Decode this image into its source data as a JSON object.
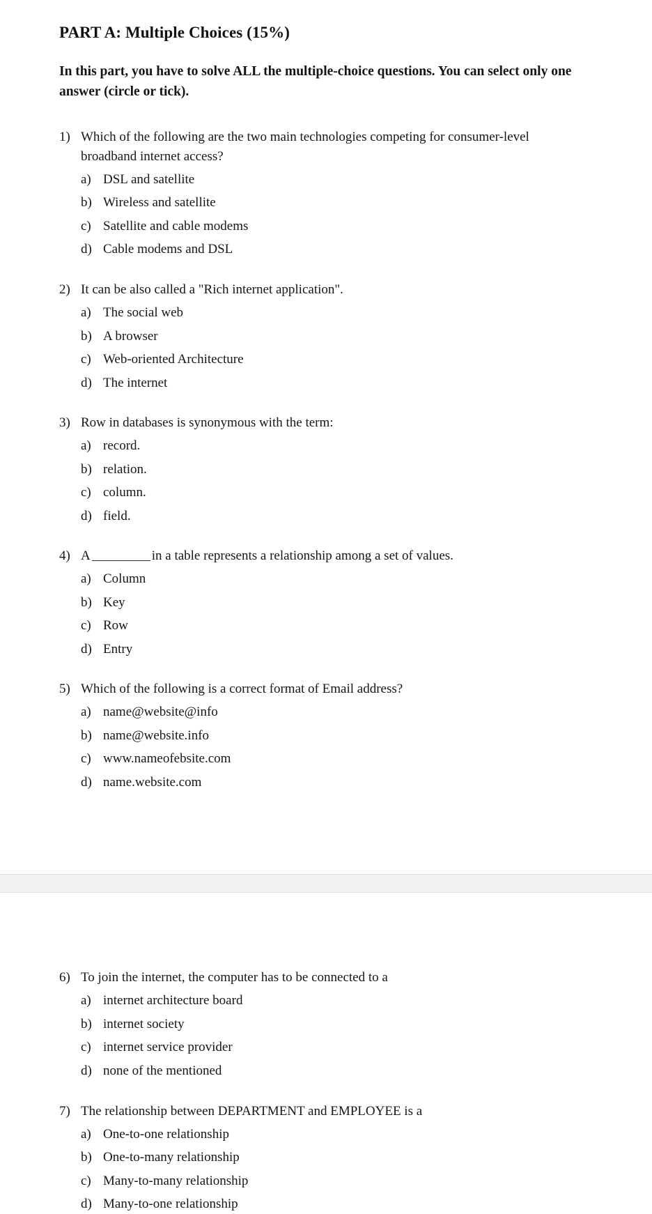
{
  "document": {
    "part_title": "PART A: Multiple Choices (15%)",
    "intro": "In this part, you have to solve ALL the multiple-choice questions. You can select only one answer (circle or tick).",
    "questions": [
      {
        "number": "1)",
        "text": "Which of the following are the two main technologies competing for consumer-level broadband internet access?",
        "options": [
          {
            "letter": "a)",
            "text": "DSL and satellite"
          },
          {
            "letter": "b)",
            "text": "Wireless and satellite"
          },
          {
            "letter": "c)",
            "text": "Satellite and cable modems"
          },
          {
            "letter": "d)",
            "text": "Cable modems and DSL"
          }
        ]
      },
      {
        "number": "2)",
        "text": "It can be also called a \"Rich internet application\".",
        "options": [
          {
            "letter": "a)",
            "text": "The social web"
          },
          {
            "letter": "b)",
            "text": "A browser"
          },
          {
            "letter": "c)",
            "text": "Web-oriented Architecture"
          },
          {
            "letter": "d)",
            "text": "The internet"
          }
        ]
      },
      {
        "number": "3)",
        "text": "Row in databases is synonymous with the term:",
        "options": [
          {
            "letter": "a)",
            "text": "record."
          },
          {
            "letter": "b)",
            "text": "relation."
          },
          {
            "letter": "c)",
            "text": "column."
          },
          {
            "letter": "d)",
            "text": "field."
          }
        ]
      },
      {
        "number": "4)",
        "text_before_blank": "A",
        "text_after_blank": "in a table represents a relationship among a set of values.",
        "has_blank": true,
        "options": [
          {
            "letter": "a)",
            "text": "Column"
          },
          {
            "letter": "b)",
            "text": "Key"
          },
          {
            "letter": "c)",
            "text": "Row"
          },
          {
            "letter": "d)",
            "text": "Entry"
          }
        ]
      },
      {
        "number": "5)",
        "text": "Which of the following is a correct format of Email address?",
        "options": [
          {
            "letter": "a)",
            "text": "name@website@info"
          },
          {
            "letter": "b)",
            "text": "name@website.info"
          },
          {
            "letter": "c)",
            "text": "www.nameofebsite.com"
          },
          {
            "letter": "d)",
            "text": "name.website.com"
          }
        ]
      },
      {
        "number": "6)",
        "text": "To join the internet, the computer has to be connected to a",
        "options": [
          {
            "letter": "a)",
            "text": "internet architecture board"
          },
          {
            "letter": "b)",
            "text": "internet society"
          },
          {
            "letter": "c)",
            "text": "internet service provider"
          },
          {
            "letter": "d)",
            "text": "none of the mentioned"
          }
        ]
      },
      {
        "number": "7)",
        "text": "The relationship between DEPARTMENT and EMPLOYEE is a",
        "options": [
          {
            "letter": "a)",
            "text": "One-to-one relationship"
          },
          {
            "letter": "b)",
            "text": "One-to-many relationship"
          },
          {
            "letter": "c)",
            "text": "Many-to-many relationship"
          },
          {
            "letter": "d)",
            "text": "Many-to-one relationship"
          }
        ]
      }
    ]
  }
}
